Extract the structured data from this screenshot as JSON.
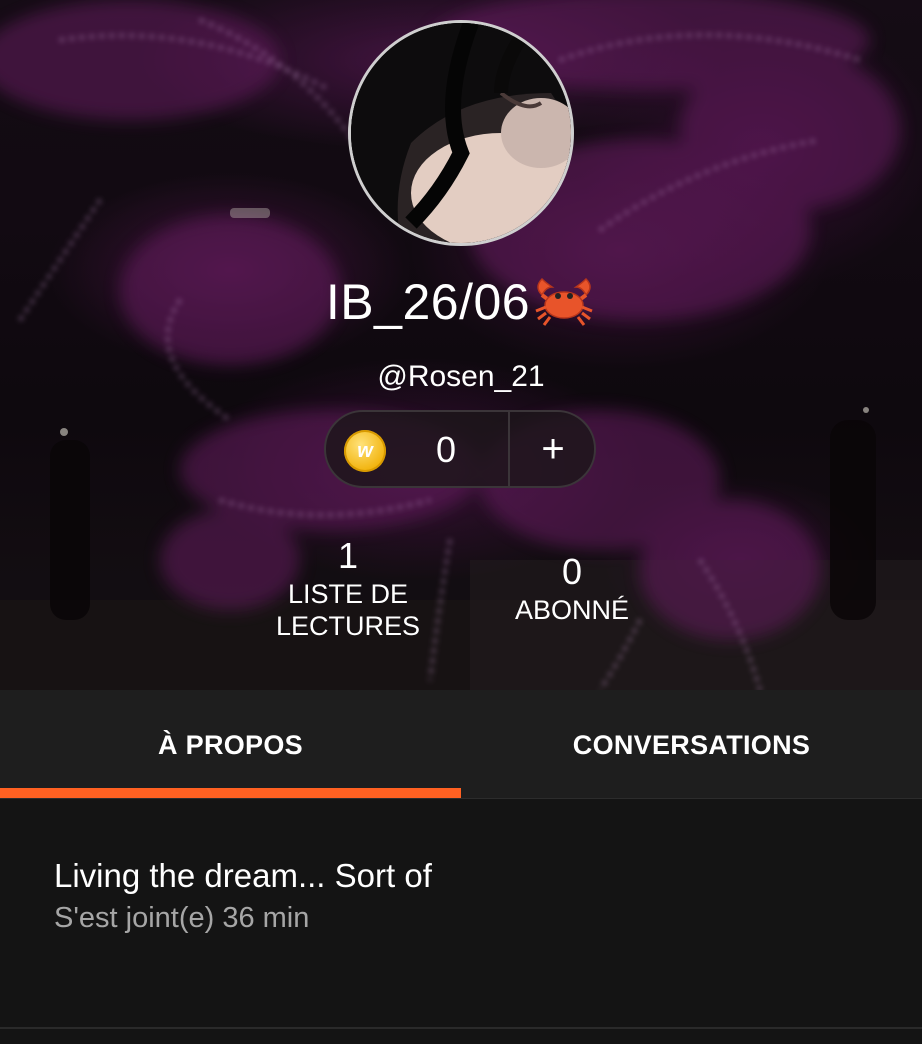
{
  "profile": {
    "display_name": "IB_26/06",
    "name_emoji": "crab-emoji",
    "handle": "@Rosen_21",
    "avatar_icon": "profile-photo"
  },
  "coins": {
    "icon": "wattpad-coin-icon",
    "coin_letter": "w",
    "count": "0",
    "add_label": "+"
  },
  "stats": {
    "reading_lists": {
      "value": "1",
      "label_line1": "LISTE DE",
      "label_line2": "LECTURES"
    },
    "followers": {
      "value": "0",
      "label": "ABONNÉ"
    }
  },
  "tabs": [
    {
      "label": "À PROPOS",
      "active": true
    },
    {
      "label": "CONVERSATIONS",
      "active": false
    }
  ],
  "about": {
    "bio": "Living the dream... Sort of",
    "joined": "S'est joint(e) 36 min"
  },
  "colors": {
    "accent": "#ff6122",
    "background": "#141414",
    "tab_bar": "#1e1e1e",
    "muted_text": "#a6a6a6",
    "coin": "#f2b40f"
  }
}
